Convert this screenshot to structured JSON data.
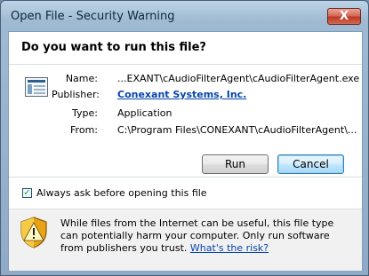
{
  "window": {
    "title": "Open File - Security Warning",
    "close_glyph": "X"
  },
  "dialog": {
    "heading": "Do you want to run this file?",
    "fields": {
      "name_label": "Name:",
      "name_value": "...EXANT\\cAudioFilterAgent\\cAudioFilterAgent.exe",
      "publisher_label": "Publisher:",
      "publisher_value": "Conexant Systems, Inc.",
      "type_label": "Type:",
      "type_value": "Application",
      "from_label": "From:",
      "from_value": "C:\\Program Files\\CONEXANT\\cAudioFilterAgent\\..."
    },
    "buttons": {
      "run": "Run",
      "cancel": "Cancel"
    },
    "checkbox": {
      "label": "Always ask before opening this file",
      "checked": true
    },
    "warning": {
      "text_before_link": "While files from the Internet can be useful, this file type can potentially harm your computer. Only run software from publishers you trust.",
      "link": "What's the risk?"
    }
  },
  "icons": {
    "file": "application-file-icon",
    "shield": "security-shield-warning-icon"
  }
}
